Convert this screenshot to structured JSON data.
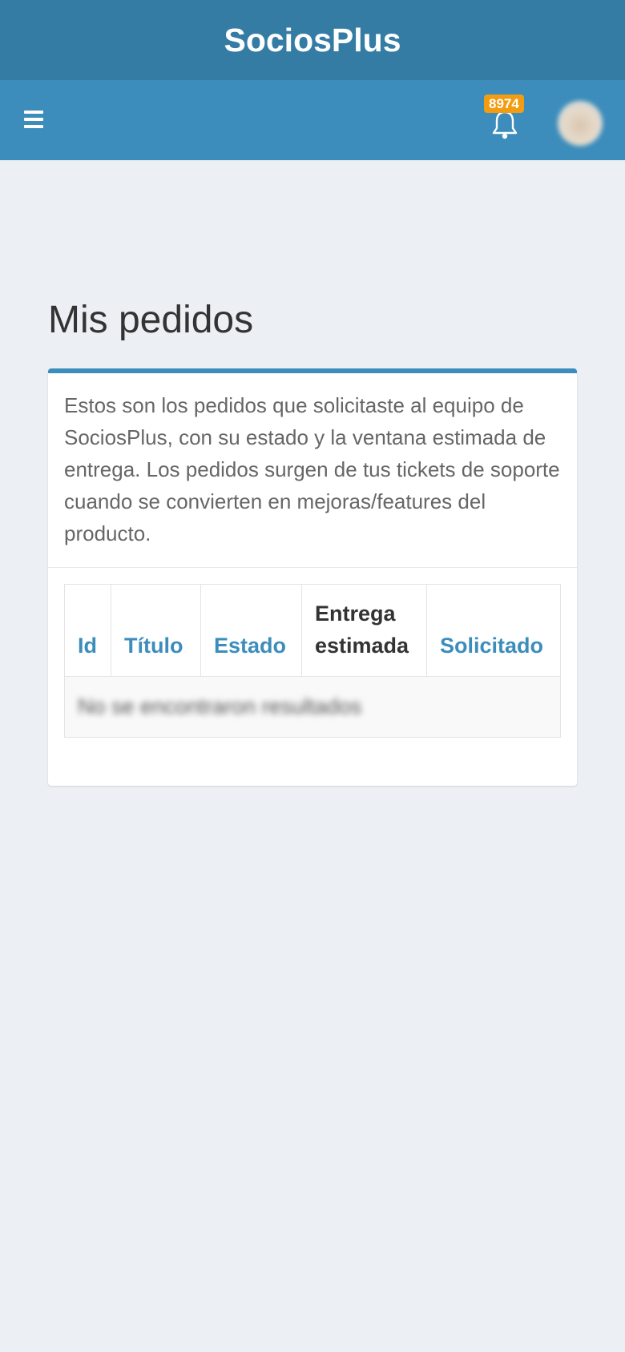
{
  "app": {
    "brand": "SociosPlus"
  },
  "navbar": {
    "menu_icon": "hamburger-icon",
    "notifications": {
      "icon": "bell-icon",
      "count": "8974"
    },
    "avatar": "user-avatar"
  },
  "page": {
    "title": "Mis pedidos",
    "description": "Estos son los pedidos que solicitaste al equipo de SociosPlus, con su estado y la ventana estimada de entrega. Los pedidos surgen de tus tickets de soporte cuando se convierten en mejoras/features del producto."
  },
  "table": {
    "headers": {
      "id": "Id",
      "title": "Título",
      "status": "Estado",
      "eta": "Entrega estimada",
      "requested": "Solicitado"
    },
    "empty_text": "No se encontraron resultados"
  },
  "colors": {
    "brand_bar": "#357ca5",
    "navbar": "#3c8dbc",
    "badge": "#f39c12",
    "link": "#3c8dbc",
    "background": "#ecf0f5"
  }
}
